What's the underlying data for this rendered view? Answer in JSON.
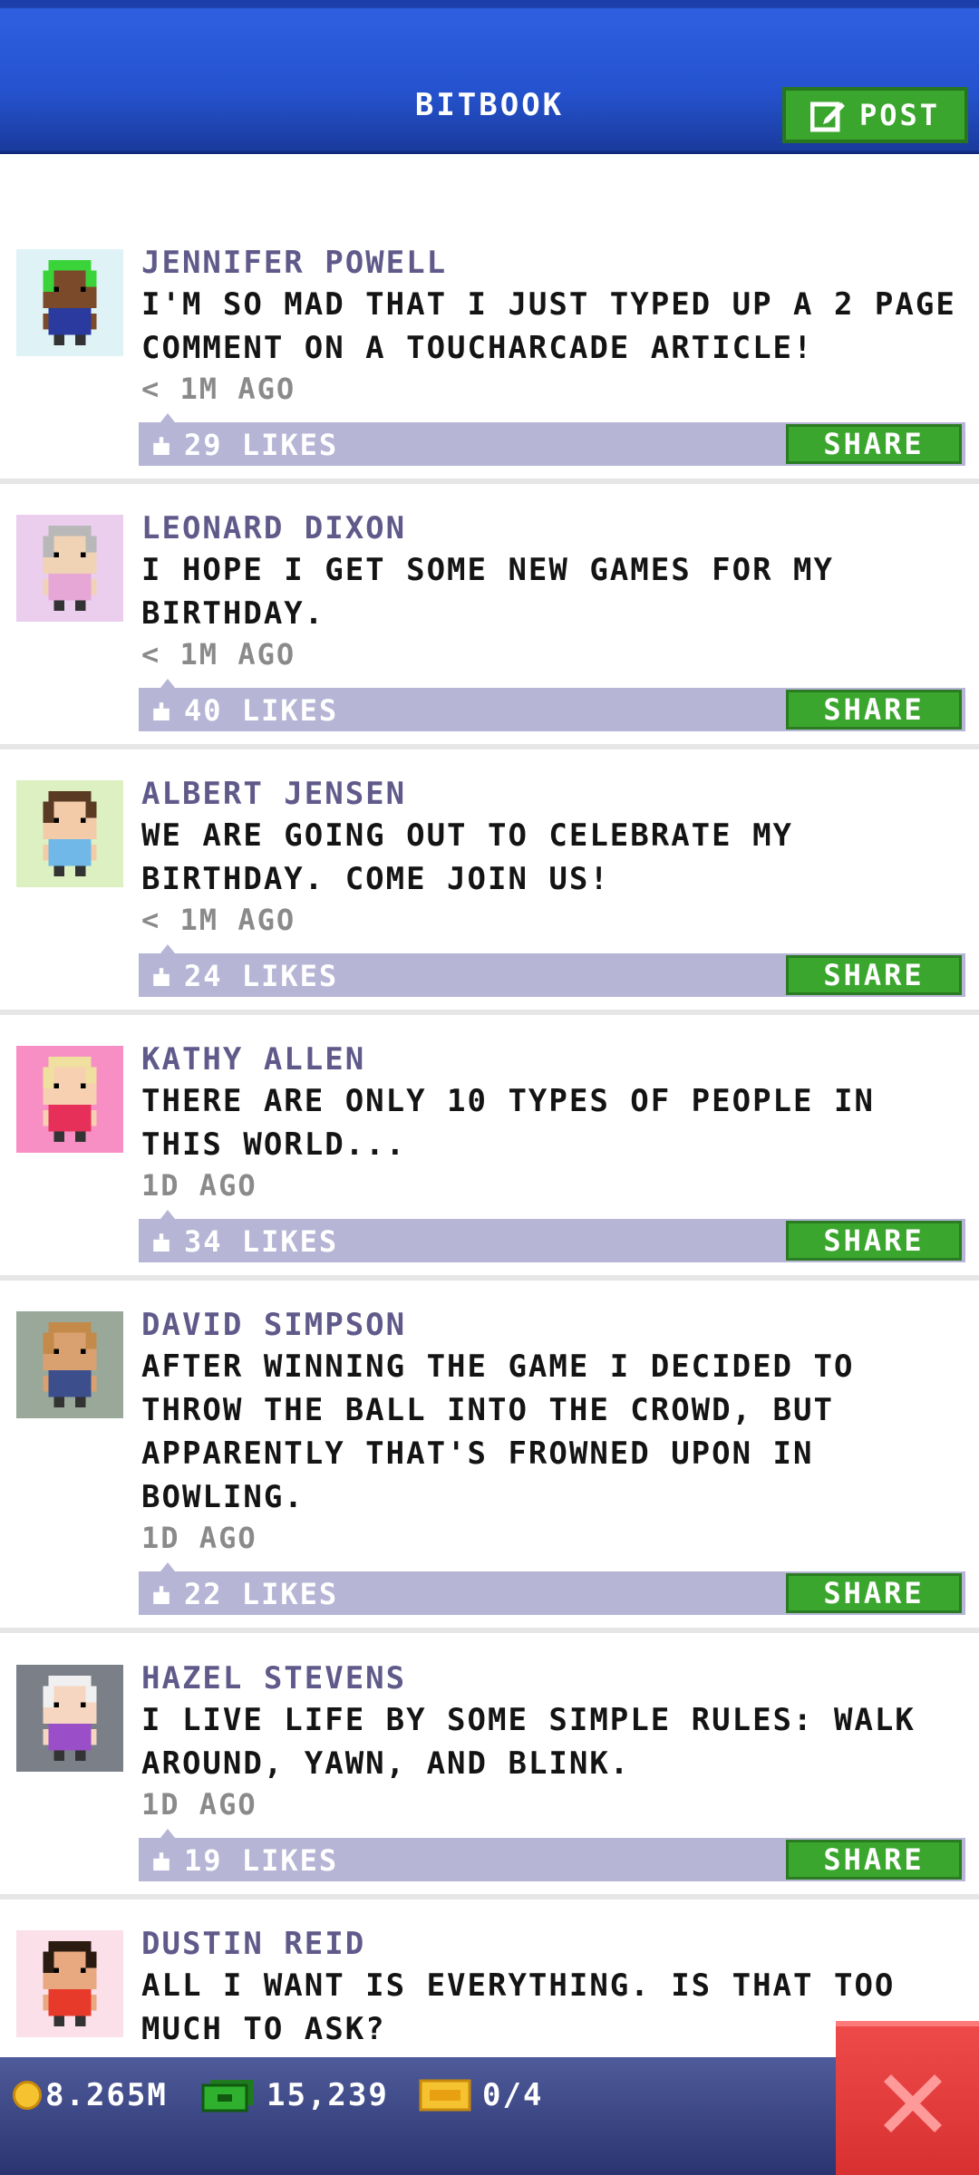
{
  "header": {
    "title": "BITBOOK",
    "post_label": "POST"
  },
  "posts": [
    {
      "name": "JENNIFER POWELL",
      "message": "I'M SO MAD THAT I JUST TYPED UP A 2 PAGE COMMENT ON A TOUCHARCADE ARTICLE!",
      "time": "< 1M AGO",
      "likes": "29 LIKES",
      "share": "SHARE",
      "avatar_bg": "#dff3f7",
      "hair": "#3ad43a",
      "skin": "#7a4a2a",
      "shirt": "#2a3a9e"
    },
    {
      "name": "LEONARD DIXON",
      "message": "I HOPE I GET SOME NEW GAMES FOR MY BIRTHDAY.",
      "time": "< 1M AGO",
      "likes": "40 LIKES",
      "share": "SHARE",
      "avatar_bg": "#ebcdee",
      "hair": "#b8b8b8",
      "skin": "#f0d2b4",
      "shirt": "#e6a6d6"
    },
    {
      "name": "ALBERT JENSEN",
      "message": "WE ARE GOING OUT TO CELEBRATE MY BIRTHDAY. COME JOIN US!",
      "time": "< 1M AGO",
      "likes": "24 LIKES",
      "share": "SHARE",
      "avatar_bg": "#dcf0c2",
      "hair": "#5a3a22",
      "skin": "#f3cba8",
      "shirt": "#6fb8e8"
    },
    {
      "name": "KATHY ALLEN",
      "message": "THERE ARE ONLY 10 TYPES OF PEOPLE IN THIS WORLD...",
      "time": "1D AGO",
      "likes": "34 LIKES",
      "share": "SHARE",
      "avatar_bg": "#f78fc4",
      "hair": "#f0e0a0",
      "skin": "#f6d0b0",
      "shirt": "#e6305a"
    },
    {
      "name": "DAVID SIMPSON",
      "message": "AFTER WINNING THE GAME I DECIDED TO THROW THE BALL INTO THE CROWD, BUT APPARENTLY THAT'S FROWNED UPON IN BOWLING.",
      "time": "1D AGO",
      "likes": "22 LIKES",
      "share": "SHARE",
      "avatar_bg": "#9aa89a",
      "hair": "#c48a4a",
      "skin": "#d9a070",
      "shirt": "#3c4e8c"
    },
    {
      "name": "HAZEL STEVENS",
      "message": "I LIVE LIFE BY SOME SIMPLE RULES: WALK AROUND, YAWN, AND BLINK.",
      "time": "1D AGO",
      "likes": "19 LIKES",
      "share": "SHARE",
      "avatar_bg": "#7b8088",
      "hair": "#f0f0f0",
      "skin": "#f6d6c0",
      "shirt": "#9a4ec8"
    },
    {
      "name": "DUSTIN REID",
      "message": "ALL I WANT IS EVERYTHING. IS THAT TOO MUCH TO ASK?",
      "time": "",
      "likes": "",
      "share": "",
      "avatar_bg": "#fbe0ea",
      "hair": "#2a1a10",
      "skin": "#e8a880",
      "shirt": "#e83a2a"
    }
  ],
  "footer": {
    "coins": "8.265M",
    "cash": "15,239",
    "tickets": "0/4"
  },
  "colors": {
    "header_blue": "#2553cf",
    "accent_green": "#3aa62e",
    "like_bar": "#b6b5d6",
    "name_purple": "#5f5a8a",
    "close_red": "#e03a3a"
  },
  "icons": [
    "edit-icon",
    "thumbs-up-icon",
    "coin-icon",
    "cash-icon",
    "ticket-icon",
    "close-icon"
  ]
}
